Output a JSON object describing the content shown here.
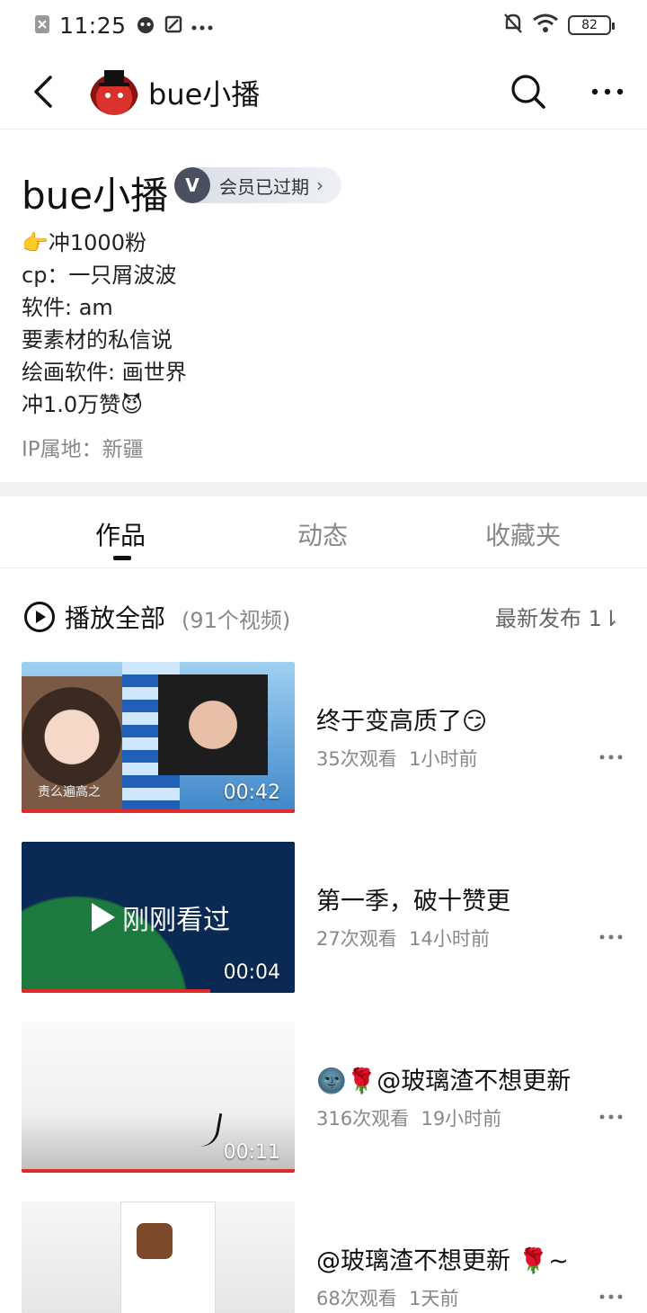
{
  "status_bar": {
    "time": "11:25",
    "battery": "82"
  },
  "nav": {
    "title": "bue小播"
  },
  "profile": {
    "name": "bue小播",
    "vip_badge_letter": "V",
    "vip_label": "会员已过期",
    "bio": [
      "👉冲1000粉",
      "cp：一只屑波波",
      "软件: am",
      "要素材的私信说",
      "绘画软件: 画世界",
      "冲1.0万赞😈"
    ],
    "ip": "IP属地：新疆"
  },
  "tabs": [
    {
      "label": "作品",
      "active": true
    },
    {
      "label": "动态",
      "active": false
    },
    {
      "label": "收藏夹",
      "active": false
    }
  ],
  "play_all": {
    "label": "播放全部",
    "count": "(91个视频)",
    "sort": "最新发布 1⇂"
  },
  "videos": [
    {
      "title": "终于变高质了😏",
      "views": "35次观看",
      "time": "1小时前",
      "duration": "00:42",
      "caption": "责么遍高之",
      "progress": 1.0
    },
    {
      "title": "第一季，破十赞更",
      "views": "27次观看",
      "time": "14小时前",
      "duration": "00:04",
      "overlay": "刚刚看过",
      "progress": 0.69
    },
    {
      "title": "🌚🌹@玻璃渣不想更新",
      "views": "316次观看",
      "time": "19小时前",
      "duration": "00:11",
      "progress": 1.0
    },
    {
      "title": "@玻璃渣不想更新 🌹~",
      "views": "68次观看",
      "time": "1天前",
      "duration": "",
      "progress": 0
    }
  ]
}
